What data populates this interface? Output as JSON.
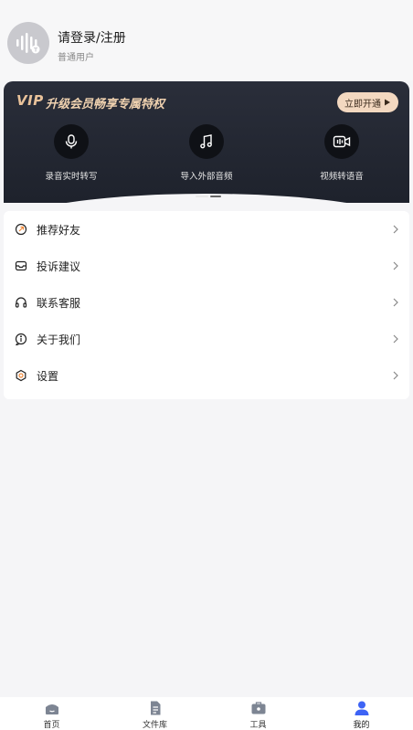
{
  "profile": {
    "login_title": "请登录/注册",
    "user_type": "普通用户"
  },
  "vip": {
    "logo": "VIP",
    "title": "升级会员畅享专属特权",
    "cta": "立即开通",
    "accent": "#f3d8c0",
    "features": [
      {
        "label": "录音实时转写",
        "icon": "microphone-icon"
      },
      {
        "label": "导入外部音频",
        "icon": "music-note-icon"
      },
      {
        "label": "视频转语音",
        "icon": "video-icon"
      }
    ]
  },
  "menu": {
    "items": [
      {
        "label": "推荐好友",
        "icon": "share-icon"
      },
      {
        "label": "投诉建议",
        "icon": "mailbox-icon"
      },
      {
        "label": "联系客服",
        "icon": "headset-icon"
      },
      {
        "label": "关于我们",
        "icon": "info-icon"
      },
      {
        "label": "设置",
        "icon": "settings-icon"
      }
    ]
  },
  "tabbar": {
    "active_color": "#3d63f5",
    "items": [
      {
        "label": "首页",
        "icon": "home-icon"
      },
      {
        "label": "文件库",
        "icon": "document-icon"
      },
      {
        "label": "工具",
        "icon": "toolbox-icon"
      },
      {
        "label": "我的",
        "icon": "user-icon",
        "active": true
      }
    ]
  }
}
